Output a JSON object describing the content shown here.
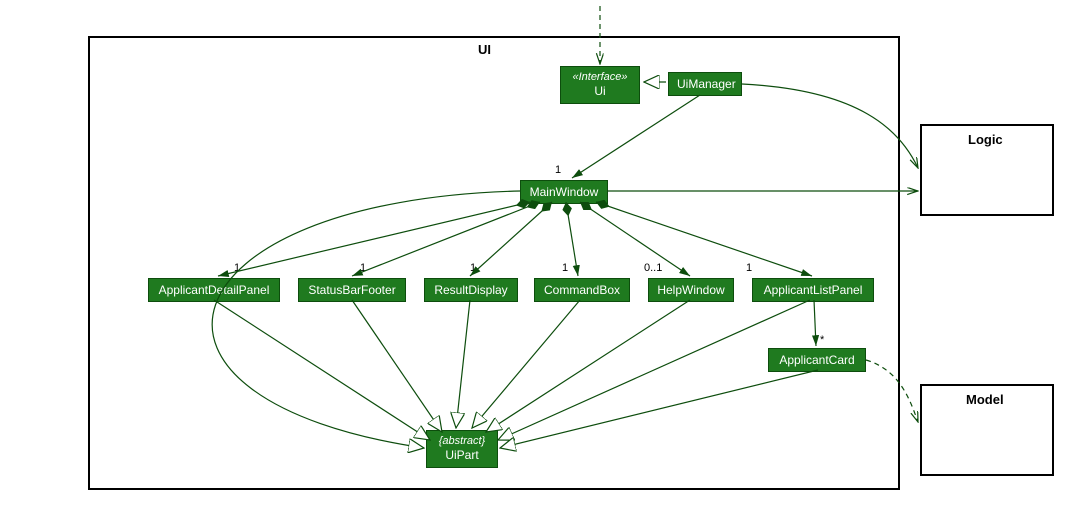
{
  "packages": {
    "ui": {
      "label": "UI"
    },
    "logic": {
      "label": "Logic"
    },
    "model": {
      "label": "Model"
    }
  },
  "nodes": {
    "interfaceUi": {
      "stereotype": "«Interface»",
      "name": "Ui"
    },
    "uiManager": {
      "name": "UiManager"
    },
    "mainWindow": {
      "name": "MainWindow"
    },
    "applicantDetailPanel": {
      "name": "ApplicantDetailPanel"
    },
    "statusBarFooter": {
      "name": "StatusBarFooter"
    },
    "resultDisplay": {
      "name": "ResultDisplay"
    },
    "commandBox": {
      "name": "CommandBox"
    },
    "helpWindow": {
      "name": "HelpWindow"
    },
    "applicantListPanel": {
      "name": "ApplicantListPanel"
    },
    "applicantCard": {
      "name": "ApplicantCard"
    },
    "uiPart": {
      "stereotype": "{abstract}",
      "name": "UiPart"
    }
  },
  "multiplicities": {
    "mainWindow": "1",
    "applicantDetailPanel": "1",
    "statusBarFooter": "1",
    "resultDisplay": "1",
    "commandBox": "1",
    "helpWindow": "0..1",
    "applicantListPanel": "1",
    "applicantCard": "*"
  },
  "colors": {
    "nodeFill": "#1f7a1f",
    "nodeBorder": "#0d4d0d",
    "lineColor": "#0d4d0d"
  }
}
